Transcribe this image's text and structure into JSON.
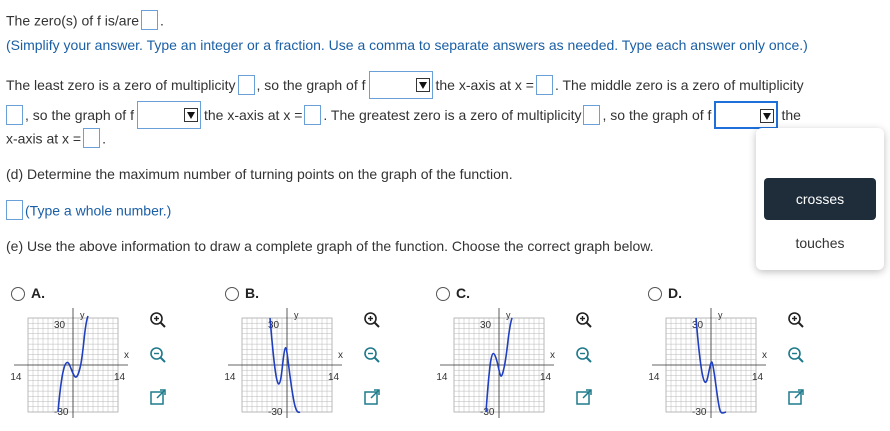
{
  "zeros_line": {
    "text": "The zero(s) of f is/are",
    "end": "."
  },
  "instructions": "(Simplify your answer. Type an integer or a fraction. Use a comma to separate answers as needed. Type each answer only once.)",
  "multiplicity": {
    "p1": "The least zero is a zero of multiplicity",
    "p2": ", so the graph of f",
    "p3": "the x-axis at x =",
    "p4": ". The middle zero is a zero of multiplicity",
    "p5": ", so the graph of f",
    "p6": "the x-axis at x =",
    "p7": ". The greatest zero is a zero of multiplicity",
    "p8": ", so the graph of f",
    "p9": "the",
    "p10": "x-axis at x =",
    "p11": "."
  },
  "dropdown_options": [
    "crosses",
    "touches"
  ],
  "part_d": {
    "question": "(d) Determine the maximum number of turning points on the graph of the function.",
    "hint": "(Type a whole number.)"
  },
  "part_e": {
    "question": "(e) Use the above information to draw a complete graph of the function. Choose the correct graph below."
  },
  "choices": [
    {
      "label": "A.",
      "ytop": "30",
      "ybot": "-30",
      "xleft": "-14",
      "xright": "14",
      "xaxis": "x",
      "yaxis": "y"
    },
    {
      "label": "B.",
      "ytop": "30",
      "ybot": "-30",
      "xleft": "-14",
      "xright": "14",
      "xaxis": "x",
      "yaxis": "y"
    },
    {
      "label": "C.",
      "ytop": "30",
      "ybot": "-30",
      "xleft": "-14",
      "xright": "14",
      "xaxis": "x",
      "yaxis": "y"
    },
    {
      "label": "D.",
      "ytop": "30",
      "ybot": "-30",
      "xleft": "-14",
      "xright": "14",
      "xaxis": "x",
      "yaxis": "y"
    }
  ],
  "colors": {
    "curve": "#1f3fbf",
    "input_border": "#6a9fd8",
    "highlight": "#1f2d3a"
  }
}
